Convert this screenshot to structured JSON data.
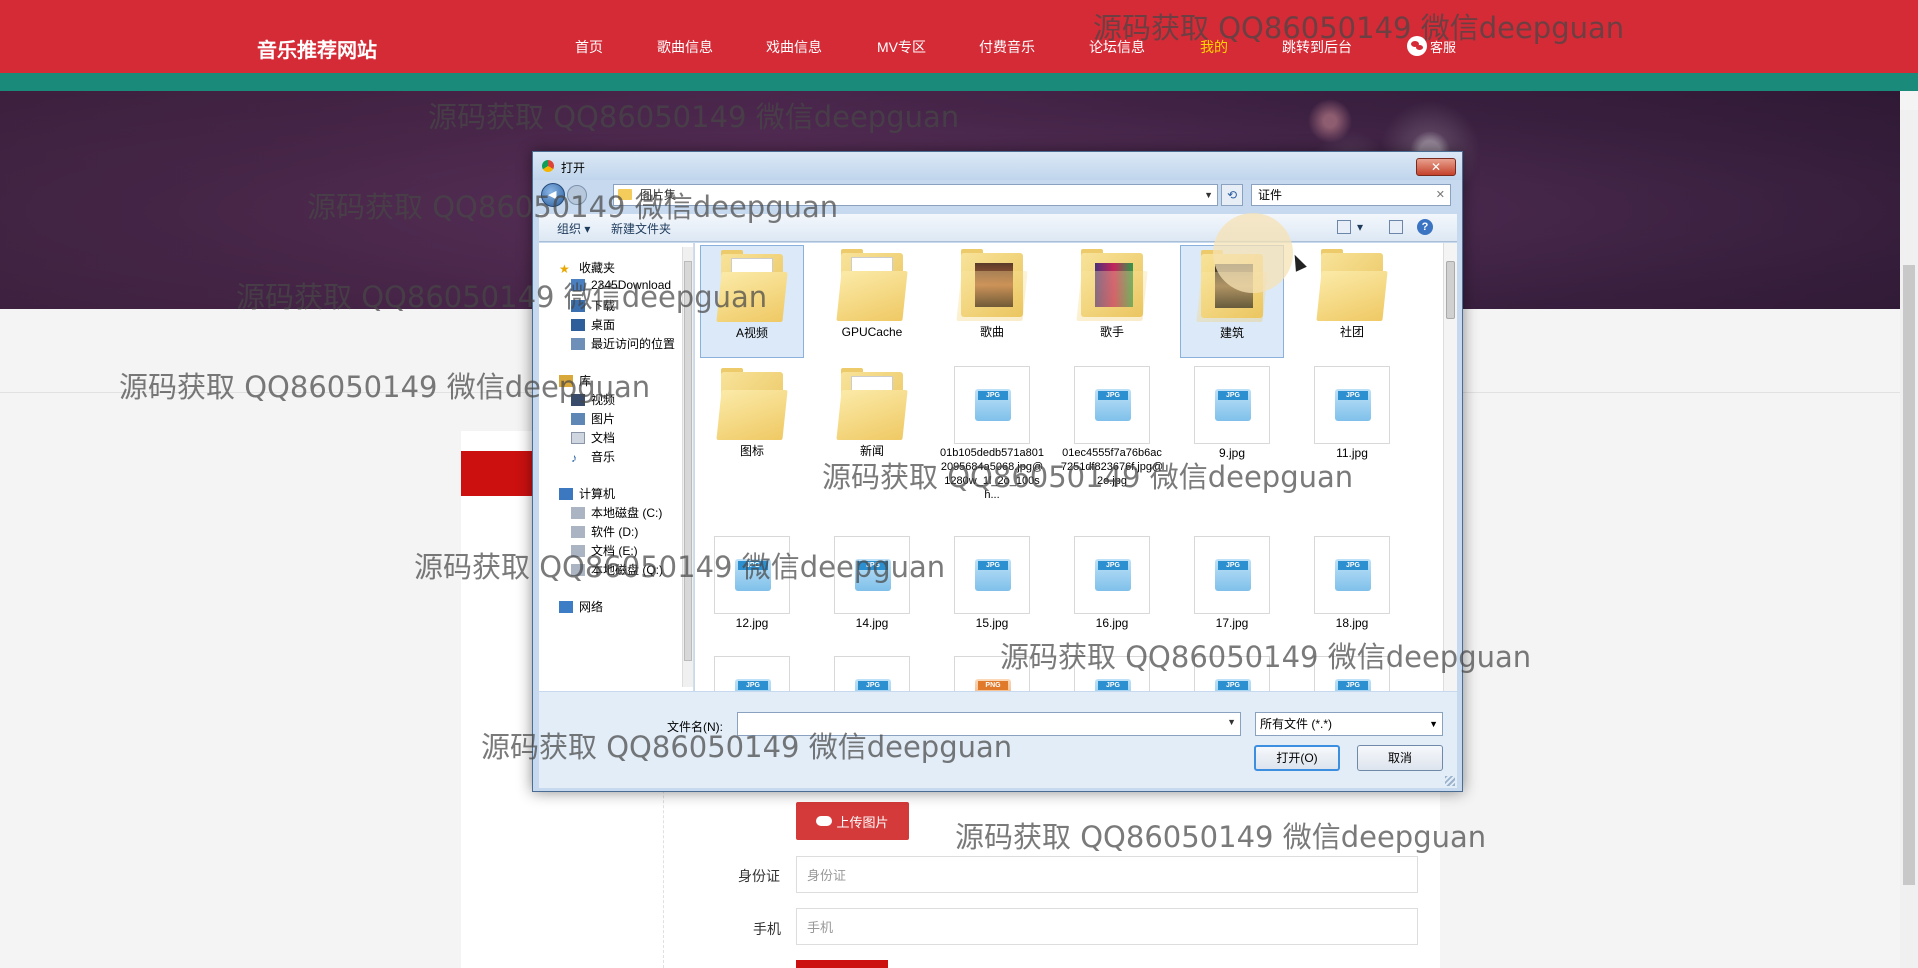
{
  "site": {
    "brand": "音乐推荐网站",
    "nav": [
      "首页",
      "歌曲信息",
      "戏曲信息",
      "MV专区",
      "付费音乐",
      "论坛信息",
      "我的",
      "跳转到后台"
    ],
    "active_nav": "我的",
    "service": "客服"
  },
  "form": {
    "upload_label": "上传图片",
    "id_label": "身份证",
    "id_placeholder": "身份证",
    "phone_label": "手机",
    "phone_placeholder": "手机"
  },
  "dialog": {
    "title": "打开",
    "path": "图片集",
    "search_value": "证件",
    "toolbar": {
      "organize": "组织",
      "new_folder": "新建文件夹"
    },
    "sidebar": {
      "favorites": "收藏夹",
      "fav_items": [
        "2345Download",
        "下载",
        "桌面",
        "最近访问的位置"
      ],
      "library": "库",
      "lib_items": [
        "视频",
        "图片",
        "文档",
        "音乐"
      ],
      "computer": "计算机",
      "drives": [
        "本地磁盘 (C:)",
        "软件 (D:)",
        "文档 (E:)",
        "本地磁盘 (Q:)"
      ],
      "network": "网络"
    },
    "files": [
      {
        "name": "A视频",
        "kind": "folder"
      },
      {
        "name": "GPUCache",
        "kind": "folder"
      },
      {
        "name": "歌曲",
        "kind": "folder"
      },
      {
        "name": "歌手",
        "kind": "folder"
      },
      {
        "name": "建筑",
        "kind": "folder"
      },
      {
        "name": "社团",
        "kind": "folder"
      },
      {
        "name": "图标",
        "kind": "folder"
      },
      {
        "name": "新闻",
        "kind": "folder"
      },
      {
        "name": "01b105dedb571a8012095684a5068.jpg@1280w_1l_2o_100sh...",
        "kind": "jpg"
      },
      {
        "name": "01ec4555f7a76b6ac7251df823676f.jpg@2o.jpg",
        "kind": "jpg"
      },
      {
        "name": "9.jpg",
        "kind": "jpg"
      },
      {
        "name": "11.jpg",
        "kind": "jpg"
      },
      {
        "name": "12.jpg",
        "kind": "jpg"
      },
      {
        "name": "14.jpg",
        "kind": "jpg"
      },
      {
        "name": "15.jpg",
        "kind": "jpg"
      },
      {
        "name": "16.jpg",
        "kind": "jpg"
      },
      {
        "name": "17.jpg",
        "kind": "jpg"
      },
      {
        "name": "18.jpg",
        "kind": "jpg"
      }
    ],
    "filename_label": "文件名(N):",
    "filename_value": "",
    "filetype": "所有文件 (*.*)",
    "open_label": "打开(O)",
    "cancel_label": "取消"
  },
  "watermark": "源码获取 QQ86050149 微信deepguan"
}
